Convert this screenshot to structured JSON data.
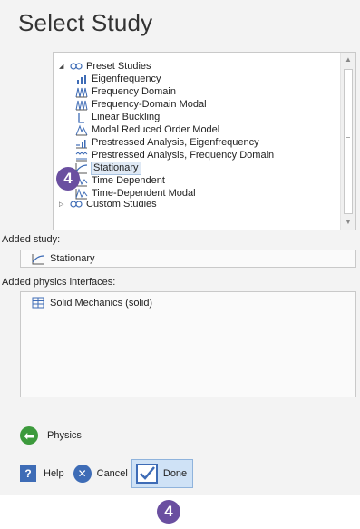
{
  "title": "Select Study",
  "tree": {
    "root_label": "Preset Studies",
    "items": [
      {
        "label": "Eigenfrequency",
        "icon": "eigenfrequency-icon"
      },
      {
        "label": "Frequency Domain",
        "icon": "frequency-domain-icon"
      },
      {
        "label": "Frequency-Domain Modal",
        "icon": "frequency-domain-modal-icon"
      },
      {
        "label": "Linear Buckling",
        "icon": "linear-buckling-icon"
      },
      {
        "label": "Modal Reduced Order Model",
        "icon": "modal-reduced-icon"
      },
      {
        "label": "Prestressed Analysis, Eigenfrequency",
        "icon": "prestressed-eigen-icon"
      },
      {
        "label": "Prestressed Analysis, Frequency Domain",
        "icon": "prestressed-freq-icon"
      },
      {
        "label": "Stationary",
        "icon": "stationary-icon",
        "selected": true
      },
      {
        "label": "Time Dependent",
        "icon": "time-dependent-icon"
      },
      {
        "label": "Time-Dependent Modal",
        "icon": "time-dependent-modal-icon"
      }
    ],
    "partial_label": "Custom Studies"
  },
  "added_study": {
    "label": "Added study:",
    "value": "Stationary"
  },
  "added_physics": {
    "label": "Added physics interfaces:",
    "value": "Solid Mechanics (solid)"
  },
  "step_badge": "4",
  "nav": {
    "physics_label": "Physics"
  },
  "footer": {
    "help_label": "Help",
    "cancel_label": "Cancel",
    "done_label": "Done"
  },
  "colors": {
    "badge": "#6a4fa0",
    "accent": "#3e6cb6",
    "green": "#3c9a3c"
  }
}
